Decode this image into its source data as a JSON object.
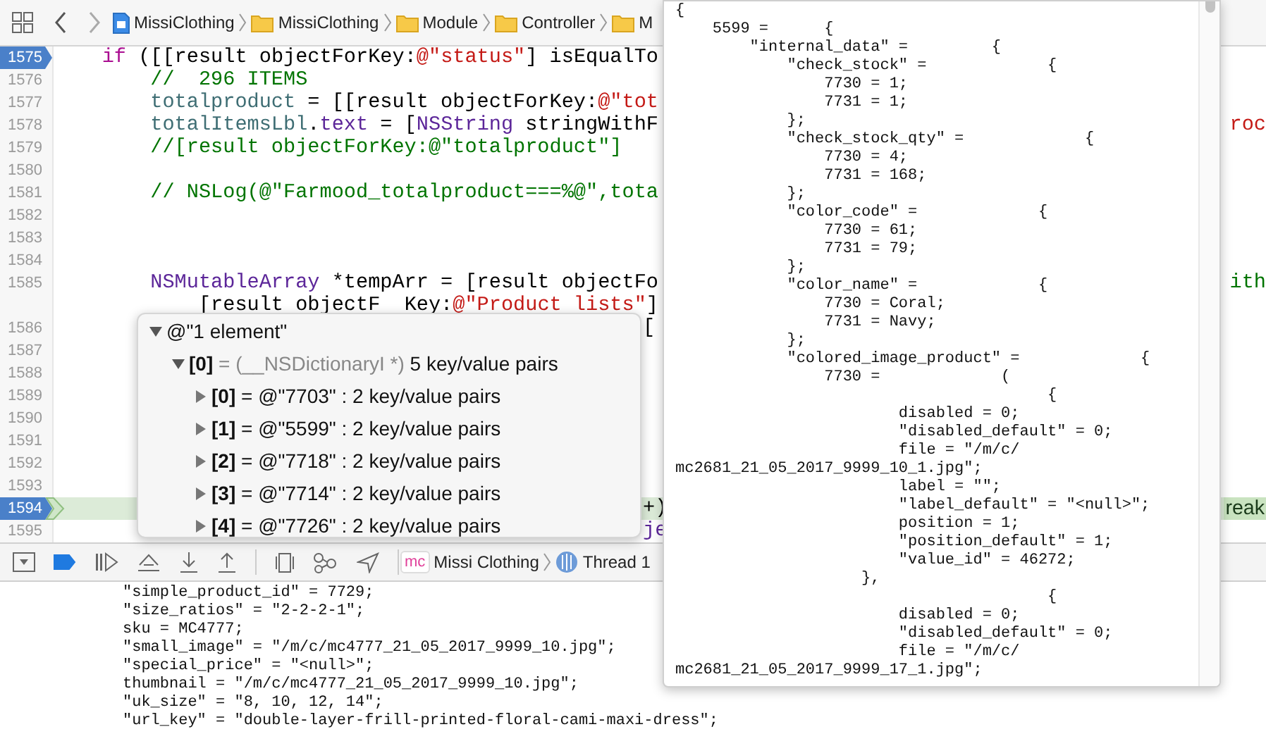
{
  "breadcrumbs": [
    {
      "kind": "file",
      "label": "MissiClothing"
    },
    {
      "kind": "folder",
      "label": "MissiClothing"
    },
    {
      "kind": "folder",
      "label": "Module"
    },
    {
      "kind": "folder",
      "label": "Controller"
    },
    {
      "kind": "folder",
      "label": "M"
    }
  ],
  "editor": {
    "lines": [
      {
        "number": "1575",
        "breakpoint": true,
        "current": false,
        "segments": [
          {
            "text": "    if",
            "kind": "keyword"
          },
          {
            "text": " ([[result objectForKey:",
            "kind": "plain"
          },
          {
            "text": "@\"status\"",
            "kind": "string"
          },
          {
            "text": "] isEqualTo",
            "kind": "plain"
          }
        ]
      },
      {
        "number": "1576",
        "breakpoint": false,
        "current": false,
        "segments": [
          {
            "text": "        //  296 ITEMS",
            "kind": "comment"
          }
        ]
      },
      {
        "number": "1577",
        "breakpoint": false,
        "current": false,
        "segments": [
          {
            "text": "        totalproduct",
            "kind": "ident"
          },
          {
            "text": " = [[result objectForKey:",
            "kind": "plain"
          },
          {
            "text": "@\"tot",
            "kind": "string"
          }
        ]
      },
      {
        "number": "1578",
        "breakpoint": false,
        "current": false,
        "segments": [
          {
            "text": "        totalItemsLbl",
            "kind": "ident"
          },
          {
            "text": ".",
            "kind": "plain"
          },
          {
            "text": "text",
            "kind": "type"
          },
          {
            "text": " = [",
            "kind": "plain"
          },
          {
            "text": "NSString",
            "kind": "type"
          },
          {
            "text": " stringWithF",
            "kind": "plain"
          }
        ],
        "tail": {
          "text": "roc",
          "kind": "string"
        }
      },
      {
        "number": "1579",
        "breakpoint": false,
        "current": false,
        "segments": [
          {
            "text": "        //[result objectForKey:@\"totalproduct\"]",
            "kind": "comment"
          }
        ]
      },
      {
        "number": "1580",
        "breakpoint": false,
        "current": false
      },
      {
        "number": "1581",
        "breakpoint": false,
        "current": false,
        "segments": [
          {
            "text": "        // NSLog(@\"Farmood_totalproduct===%@\",tota",
            "kind": "comment"
          }
        ]
      },
      {
        "number": "1582",
        "breakpoint": false,
        "current": false
      },
      {
        "number": "1583",
        "breakpoint": false,
        "current": false
      },
      {
        "number": "1584",
        "breakpoint": false,
        "current": false
      },
      {
        "number": "1585",
        "breakpoint": false,
        "current": false,
        "segments": [
          {
            "text": "        NSMutableArray",
            "kind": "type"
          },
          {
            "text": " *tempArr = [result objectFo",
            "kind": "plain"
          }
        ],
        "tail": {
          "text": "ith",
          "kind": "comment"
        }
      },
      {
        "segments": [
          {
            "text": "            [result objectF",
            "kind": "plain"
          },
          {
            "text": "  Key:",
            "kind": "plain"
          },
          {
            "text": "@\"Product lists\"",
            "kind": "string"
          },
          {
            "text": "]",
            "kind": "plain"
          }
        ]
      },
      {
        "number": "1586",
        "breakpoint": false,
        "current": false,
        "fragment": {
          "text": "[",
          "kind": "plain"
        }
      },
      {
        "number": "1587",
        "breakpoint": false,
        "current": false
      },
      {
        "number": "1588",
        "breakpoint": false,
        "current": false
      },
      {
        "number": "1589",
        "breakpoint": false,
        "current": false
      },
      {
        "number": "1590",
        "breakpoint": false,
        "current": false
      },
      {
        "number": "1591",
        "breakpoint": false,
        "current": false
      },
      {
        "number": "1592",
        "breakpoint": false,
        "current": false
      },
      {
        "number": "1593",
        "breakpoint": false,
        "current": false
      },
      {
        "number": "1594",
        "breakpoint": true,
        "current": true,
        "fragment": {
          "text": "+)",
          "kind": "plain"
        },
        "tail": {
          "text": "reak",
          "kind": "badge"
        }
      },
      {
        "number": "1595",
        "breakpoint": false,
        "current": false,
        "fragment": {
          "text": "je",
          "kind": "type"
        }
      }
    ]
  },
  "variables_popover": {
    "summary": "@\"1 element\"",
    "expanded": true,
    "children": [
      {
        "index": "[0]",
        "type": "= (__NSDictionaryI *)",
        "summary": "5 key/value pairs",
        "expanded": true,
        "children": [
          {
            "index": "[0]",
            "summary": "= @\"7703\" : 2 key/value pairs",
            "expanded": false
          },
          {
            "index": "[1]",
            "summary": "= @\"5599\" : 2 key/value pairs",
            "expanded": false
          },
          {
            "index": "[2]",
            "summary": "= @\"7718\" : 2 key/value pairs",
            "expanded": false
          },
          {
            "index": "[3]",
            "summary": "= @\"7714\" : 2 key/value pairs",
            "expanded": false
          },
          {
            "index": "[4]",
            "summary": "= @\"7726\" : 2 key/value pairs",
            "expanded": false
          }
        ]
      }
    ]
  },
  "debug_bar": {
    "breakpoints_active": true,
    "app_badge": "mc",
    "app_name": "Missi Clothing",
    "thread": "Thread 1"
  },
  "console": {
    "lines": [
      "\"simple_product_id\" = 7729;",
      "\"size_ratios\" = \"2-2-2-1\";",
      "sku = MC4777;",
      "\"small_image\" = \"/m/c/mc4777_21_05_2017_9999_10.jpg\";",
      "\"special_price\" = \"<null>\";",
      "thumbnail = \"/m/c/mc4777_21_05_2017_9999_10.jpg\";",
      "\"uk_size\" = \"8, 10, 12, 14\";",
      "\"url_key\" = \"double-layer-frill-printed-floral-cami-maxi-dress\";"
    ]
  },
  "dump_popover": {
    "lines": [
      "{",
      "    5599 =      {",
      "        \"internal_data\" =         {",
      "            \"check_stock\" =             {",
      "                7730 = 1;",
      "                7731 = 1;",
      "            };",
      "            \"check_stock_qty\" =             {",
      "                7730 = 4;",
      "                7731 = 168;",
      "            };",
      "            \"color_code\" =             {",
      "                7730 = 61;",
      "                7731 = 79;",
      "            };",
      "            \"color_name\" =             {",
      "                7730 = Coral;",
      "                7731 = Navy;",
      "            };",
      "            \"colored_image_product\" =             {",
      "                7730 =             (",
      "                                        {",
      "                        disabled = 0;",
      "                        \"disabled_default\" = 0;",
      "                        file = \"/m/c/",
      "mc2681_21_05_2017_9999_10_1.jpg\";",
      "                        label = \"\";",
      "                        \"label_default\" = \"<null>\";",
      "                        position = 1;",
      "                        \"position_default\" = 1;",
      "                        \"value_id\" = 46272;",
      "                    },",
      "                                        {",
      "                        disabled = 0;",
      "                        \"disabled_default\" = 0;",
      "                        file = \"/m/c/",
      "mc2681_21_05_2017_9999_17_1.jpg\";"
    ]
  }
}
